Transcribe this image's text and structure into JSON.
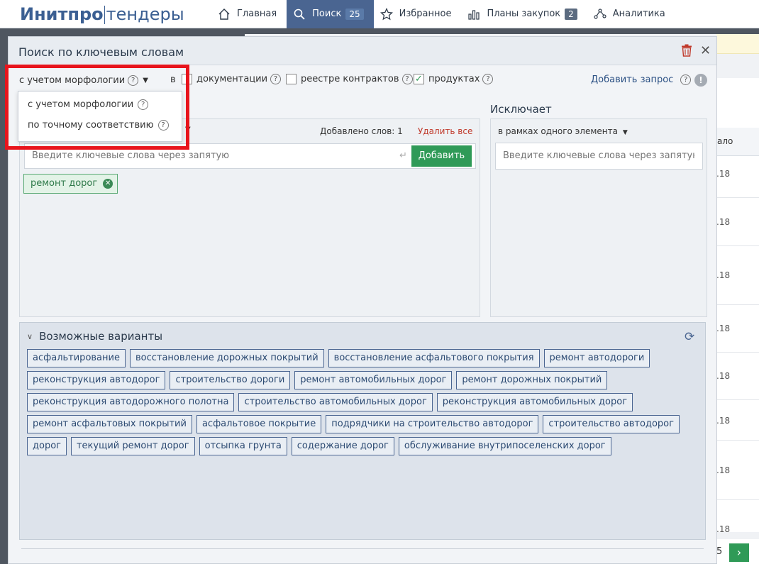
{
  "logo": {
    "part1": "Инитпро",
    "part2": "тендеры"
  },
  "nav": [
    {
      "label": "Главная",
      "icon": "home-icon"
    },
    {
      "label": "Поиск",
      "icon": "search-icon",
      "badge": "25",
      "active": true
    },
    {
      "label": "Избранное",
      "icon": "star-icon"
    },
    {
      "label": "Планы закупок",
      "icon": "chart-bar-icon",
      "badge": "2"
    },
    {
      "label": "Аналитика",
      "icon": "analytics-icon"
    }
  ],
  "modal": {
    "title": "Поиск по ключевым словам",
    "morphology_label": "с учетом морфологии",
    "in_label": "в",
    "checkboxes": [
      {
        "label": "документации",
        "checked": false
      },
      {
        "label": "реестре контрактов",
        "checked": false
      },
      {
        "label": "продуктах",
        "checked": true
      }
    ],
    "add_query": "Добавить запрос"
  },
  "dropdown": {
    "items": [
      "с учетом морфологии",
      "по точному соответствию"
    ]
  },
  "include": {
    "words_count": "Добавлено слов: 1",
    "delete_all": "Удалить все",
    "placeholder": "Введите ключевые слова через запятую",
    "add_button": "Добавить",
    "tags": [
      "ремонт дорог"
    ]
  },
  "exclude": {
    "title": "Исключает",
    "mode": "в рамках одного элемента",
    "placeholder": "Введите ключевые слова через запятую"
  },
  "suggestions": {
    "title": "Возможные варианты",
    "items": [
      "асфальтирование",
      "восстановление дорожных покрытий",
      "восстановление асфальтового покрытия",
      "ремонт автодороги",
      "реконструкция автодорог",
      "строительство дороги",
      "ремонт автомобильных дорог",
      "ремонт дорожных покрытий",
      "реконструкция автодорожного полотна",
      "строительство автомобильных дорог",
      "реконструкция автомобильных дорог",
      "ремонт асфальтовых покрытий",
      "асфальтовое покрытие",
      "подрядчики на строительство автодорог",
      "строительство автодорог",
      "дорог",
      "текущий ремонт дорог",
      "отсыпка грунта",
      "содержание дорог",
      "обслуживание внутрипоселенских дорог"
    ]
  },
  "background": {
    "column_header": "ало",
    "rows": [
      ".18",
      ".18",
      ".18",
      ".18",
      ".18",
      ".18",
      ".18",
      ".18"
    ],
    "pager_num": "5"
  },
  "colors": {
    "accent": "#4a6591",
    "green": "#2f9a57",
    "highlight": "#e8141c"
  }
}
